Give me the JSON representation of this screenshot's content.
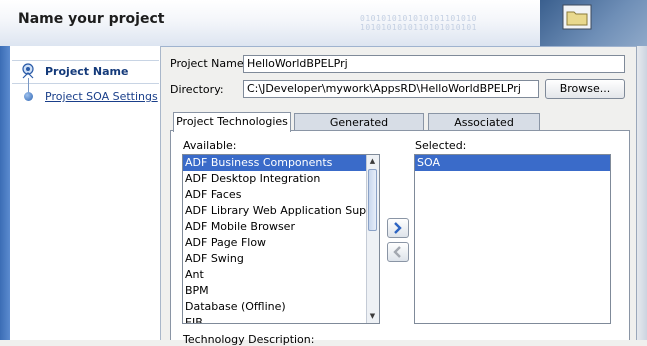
{
  "header": {
    "title": "Name your project",
    "binary_lines": [
      "0101010101010101101010",
      "1010101010110101010101"
    ]
  },
  "nav": {
    "steps": [
      {
        "label": "Project Name",
        "active": true
      },
      {
        "label": "Project SOA Settings",
        "active": false
      }
    ]
  },
  "form": {
    "project_name_label": "Project Name:",
    "project_name_value": "HelloWorldBPELPrj",
    "directory_label": "Directory:",
    "directory_value": "C:\\JDeveloper\\mywork\\AppsRD\\HelloWorldBPELPrj",
    "browse_label": "Browse..."
  },
  "tabs": [
    {
      "label": "Project Technologies",
      "active": true
    },
    {
      "label": "Generated Components",
      "active": false
    },
    {
      "label": "Associated Libraries",
      "active": false
    }
  ],
  "available": {
    "label": "Available:",
    "items": [
      "ADF Business Components",
      "ADF Desktop Integration",
      "ADF Faces",
      "ADF Library Web Application Support",
      "ADF Mobile Browser",
      "ADF Page Flow",
      "ADF Swing",
      "Ant",
      "BPM",
      "Database (Offline)",
      "EJB"
    ],
    "selected_index": 0
  },
  "selected": {
    "label": "Selected:",
    "items": [
      "SOA"
    ],
    "selected_index": 0
  },
  "description_label": "Technology Description:",
  "colors": {
    "selection": "#3a6bc9",
    "nav_link": "#1a3f8a",
    "window_edge": "#3b6db5"
  },
  "icons": {
    "move_right": "arrow-right-icon",
    "move_left": "arrow-left-icon",
    "folder": "folder-icon"
  }
}
